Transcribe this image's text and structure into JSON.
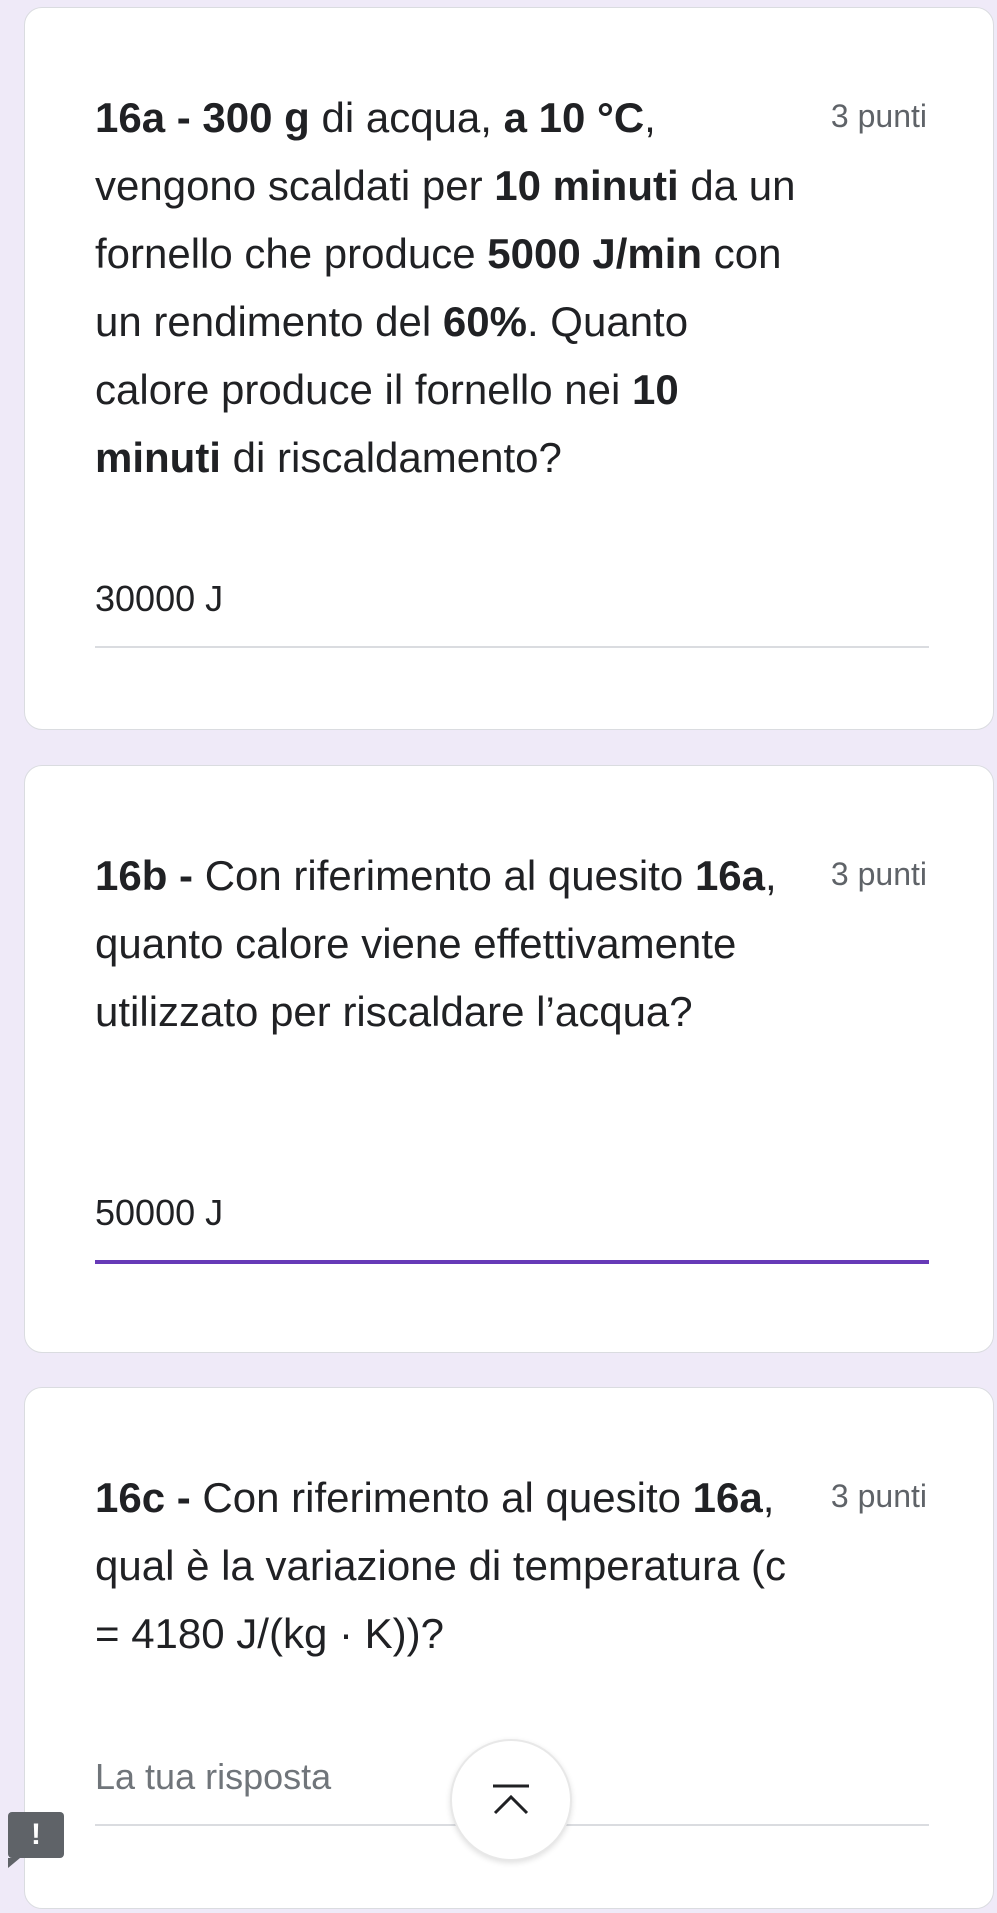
{
  "questions": [
    {
      "text_html": "<b>16a - 300 g</b> di acqua, <b>a 10 °C</b>, vengono scaldati per <b>10 minuti</b> da un fornello che produce <b>5000 J/min</b> con un rendimento del <b>60%</b>. Quanto calore produce il fornello nei <b>10 minuti</b> di riscaldamento?",
      "points": "3 punti",
      "answer": "30000 J"
    },
    {
      "text_html": "<b>16b -</b> Con riferimento al quesito <b>16a</b>, quanto calore viene effettivamente utilizzato per riscaldare l’acqua?",
      "points": "3 punti",
      "answer": "50000 J"
    },
    {
      "text_html": "<b>16c -</b> Con riferimento al quesito <b>16a</b>, qual è la variazione di temperatura (c = 4180 J/(kg · K))?",
      "points": "3 punti",
      "placeholder": "La tua risposta"
    }
  ],
  "icons": {
    "scroll_top": "chevron-up-bar-icon",
    "feedback": "report-issue-icon"
  },
  "feedback_label": "!",
  "colors": {
    "accent": "#673ab7",
    "background": "#efeaf8"
  }
}
